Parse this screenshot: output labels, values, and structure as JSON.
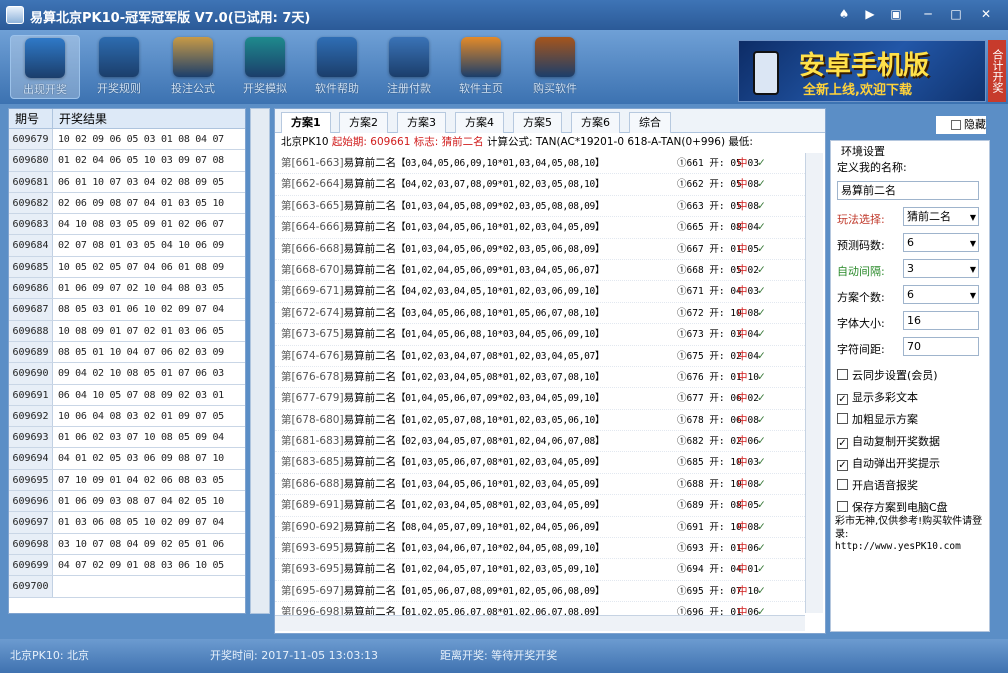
{
  "window": {
    "title": "易算北京PK10-冠军冠军版 V7.0(已试用: 7天)",
    "controls": [
      "♠",
      "▶",
      "▣",
      "─",
      "□",
      "✕"
    ]
  },
  "toolbar": [
    {
      "label": "出现开奖",
      "color": "#2f79c7"
    },
    {
      "label": "开奖规则",
      "color": "#2d6cb0"
    },
    {
      "label": "投注公式",
      "color": "#c89a46"
    },
    {
      "label": "开奖模拟",
      "color": "#1e8a8d"
    },
    {
      "label": "软件帮助",
      "color": "#2f6eb5"
    },
    {
      "label": "注册付款",
      "color": "#3a73b7"
    },
    {
      "label": "软件主页",
      "color": "#e48a28"
    },
    {
      "label": "购买软件",
      "color": "#a5551c"
    }
  ],
  "banner": {
    "title": "安卓手机版",
    "subtitle": "全新上线,欢迎下载",
    "side_tab": "合计开奖"
  },
  "history": {
    "headers": [
      "期号",
      "开奖结果"
    ],
    "rows": [
      {
        "p": "609679",
        "r": "10 02 09 06 05 03 01 08 04 07"
      },
      {
        "p": "609680",
        "r": "01 02 04 06 05 10 03 09 07 08"
      },
      {
        "p": "609681",
        "r": "06 01 10 07 03 04 02 08 09 05"
      },
      {
        "p": "609682",
        "r": "02 06 09 08 07 04 01 03 05 10"
      },
      {
        "p": "609683",
        "r": "04 10 08 03 05 09 01 02 06 07"
      },
      {
        "p": "609684",
        "r": "02 07 08 01 03 05 04 10 06 09"
      },
      {
        "p": "609685",
        "r": "10 05 02 05 07 04 06 01 08 09"
      },
      {
        "p": "609686",
        "r": "01 06 09 07 02 10 04 08 03 05"
      },
      {
        "p": "609687",
        "r": "08 05 03 01 06 10 02 09 07 04"
      },
      {
        "p": "609688",
        "r": "10 08 09 01 07 02 01 03 06 05"
      },
      {
        "p": "609689",
        "r": "08 05 01 10 04 07 06 02 03 09"
      },
      {
        "p": "609690",
        "r": "09 04 02 10 08 05 01 07 06 03"
      },
      {
        "p": "609691",
        "r": "06 04 10 05 07 08 09 02 03 01"
      },
      {
        "p": "609692",
        "r": "10 06 04 08 03 02 01 09 07 05"
      },
      {
        "p": "609693",
        "r": "01 06 02 03 07 10 08 05 09 04"
      },
      {
        "p": "609694",
        "r": "04 01 02 05 03 06 09 08 07 10"
      },
      {
        "p": "609695",
        "r": "07 10 09 01 04 02 06 08 03 05"
      },
      {
        "p": "609696",
        "r": "01 06 09 03 08 07 04 02 05 10"
      },
      {
        "p": "609697",
        "r": "01 03 06 08 05 10 02 09 07 04"
      },
      {
        "p": "609698",
        "r": "03 10 07 08 04 09 02 05 01 06"
      },
      {
        "p": "609699",
        "r": "04 07 02 09 01 08 03 06 10 05"
      },
      {
        "p": "609700",
        "r": ""
      }
    ]
  },
  "tabs": [
    "方案1",
    "方案2",
    "方案3",
    "方案4",
    "方案5",
    "方案6",
    "综合"
  ],
  "info": {
    "prefix": "北京PK10",
    "start_label": "起始期: 609661",
    "name_label": "标志: 猜前二名",
    "formula": "计算公式: TAN(AC*19201-0 618-A-TAN(0+996) 最低:"
  },
  "plans": [
    {
      "range": "第[661-663]",
      "name": "易算前二名",
      "nums": "【03,04,05,06,09,10*01,03,04,05,08,10】",
      "kai": "①661 开: 05 03",
      "hit": "中",
      "ok": "✓"
    },
    {
      "range": "第[662-664]",
      "name": "易算前二名",
      "nums": "【04,02,03,07,08,09*01,02,03,05,08,10】",
      "kai": "①662 开: 05 08",
      "hit": "中",
      "ok": "✓"
    },
    {
      "range": "第[663-665]",
      "name": "易算前二名",
      "nums": "【01,03,04,05,08,09*02,03,05,08,08,09】",
      "kai": "①663 开: 05 08",
      "hit": "中",
      "ok": "✓"
    },
    {
      "range": "第[664-666]",
      "name": "易算前二名",
      "nums": "【01,03,04,05,06,10*01,02,03,04,05,09】",
      "kai": "①665 开: 08 04",
      "hit": "中",
      "ok": "✓"
    },
    {
      "range": "第[666-668]",
      "name": "易算前二名",
      "nums": "【01,03,04,05,06,09*02,03,05,06,08,09】",
      "kai": "①667 开: 01 05",
      "hit": "中",
      "ok": "✓"
    },
    {
      "range": "第[668-670]",
      "name": "易算前二名",
      "nums": "【01,02,04,05,06,09*01,03,04,05,06,07】",
      "kai": "①668 开: 05 02",
      "hit": "中",
      "ok": "✓"
    },
    {
      "range": "第[669-671]",
      "name": "易算前二名",
      "nums": "【04,02,03,04,05,10*01,02,03,06,09,10】",
      "kai": "①671 开: 04 03",
      "hit": "中",
      "ok": "✓"
    },
    {
      "range": "第[672-674]",
      "name": "易算前二名",
      "nums": "【03,04,05,06,08,10*01,05,06,07,08,10】",
      "kai": "①672 开: 10 08",
      "hit": "中",
      "ok": "✓"
    },
    {
      "range": "第[673-675]",
      "name": "易算前二名",
      "nums": "【01,04,05,06,08,10*03,04,05,06,09,10】",
      "kai": "①673 开: 03 04",
      "hit": "中",
      "ok": "✓"
    },
    {
      "range": "第[674-676]",
      "name": "易算前二名",
      "nums": "【01,02,03,04,07,08*01,02,03,04,05,07】",
      "kai": "①675 开: 02 04",
      "hit": "中",
      "ok": "✓"
    },
    {
      "range": "第[676-678]",
      "name": "易算前二名",
      "nums": "【01,02,03,04,05,08*01,02,03,07,08,10】",
      "kai": "①676 开: 01 10",
      "hit": "中",
      "ok": "✓"
    },
    {
      "range": "第[677-679]",
      "name": "易算前二名",
      "nums": "【01,04,05,06,07,09*02,03,04,05,09,10】",
      "kai": "①677 开: 06 02",
      "hit": "中",
      "ok": "✓"
    },
    {
      "range": "第[678-680]",
      "name": "易算前二名",
      "nums": "【01,02,05,07,08,10*01,02,03,05,06,10】",
      "kai": "①678 开: 06 08",
      "hit": "中",
      "ok": "✓"
    },
    {
      "range": "第[681-683]",
      "name": "易算前二名",
      "nums": "【02,03,04,05,07,08*01,02,04,06,07,08】",
      "kai": "①682 开: 02 06",
      "hit": "中",
      "ok": "✓"
    },
    {
      "range": "第[683-685]",
      "name": "易算前二名",
      "nums": "【01,03,05,06,07,08*01,02,03,04,05,09】",
      "kai": "①685 开: 10 03",
      "hit": "中",
      "ok": "✓"
    },
    {
      "range": "第[686-688]",
      "name": "易算前二名",
      "nums": "【01,03,04,05,06,10*01,02,03,04,05,09】",
      "kai": "①688 开: 10 08",
      "hit": "中",
      "ok": "✓"
    },
    {
      "range": "第[689-691]",
      "name": "易算前二名",
      "nums": "【01,02,03,04,05,08*01,02,03,04,05,09】",
      "kai": "①689 开: 08 05",
      "hit": "中",
      "ok": "✓"
    },
    {
      "range": "第[690-692]",
      "name": "易算前二名",
      "nums": "【08,04,05,07,09,10*01,02,04,05,06,09】",
      "kai": "①691 开: 10 08",
      "hit": "中",
      "ok": "✓"
    },
    {
      "range": "第[693-695]",
      "name": "易算前二名",
      "nums": "【01,03,04,06,07,10*02,04,05,08,09,10】",
      "kai": "①693 开: 01 06",
      "hit": "中",
      "ok": "✓"
    },
    {
      "range": "第[693-695]",
      "name": "易算前二名",
      "nums": "【01,02,04,05,07,10*01,02,03,05,09,10】",
      "kai": "①694 开: 04 01",
      "hit": "中",
      "ok": "✓"
    },
    {
      "range": "第[695-697]",
      "name": "易算前二名",
      "nums": "【01,05,06,07,08,09*01,02,05,06,08,09】",
      "kai": "①695 开: 07 10",
      "hit": "中",
      "ok": "✓"
    },
    {
      "range": "第[696-698]",
      "name": "易算前二名",
      "nums": "【01,02,05,06,07,08*01,02,06,07,08,09】",
      "kai": "①696 开: 01 06",
      "hit": "中",
      "ok": "✓"
    }
  ],
  "settings": {
    "title": "环境设置",
    "hide_label": "隐藏",
    "name_label": "定义我的名称:",
    "name_value": "易算前二名",
    "play_label": "玩法选择:",
    "play_value": "猜前二名",
    "predict_label": "预测码数:",
    "predict_value": "6",
    "interval_label": "自动间隔:",
    "interval_value": "3",
    "lines_label": "方案个数:",
    "lines_value": "6",
    "font_label": "字体大小:",
    "font_value": "16",
    "spacing_label": "字符间距:",
    "spacing_value": "70",
    "checks": [
      {
        "label": "云同步设置(会员)",
        "checked": false
      },
      {
        "label": "显示多彩文本",
        "checked": true
      },
      {
        "label": "加粗显示方案",
        "checked": false
      },
      {
        "label": "自动复制开奖数据",
        "checked": true
      },
      {
        "label": "自动弹出开奖提示",
        "checked": true
      },
      {
        "label": "开启语音报奖",
        "checked": false
      },
      {
        "label": "保存方案到电脑C盘",
        "checked": false
      }
    ],
    "note": "彩市无神,仅供参考!购买软件请登录:",
    "url": "http://www.yesPK10.com"
  },
  "status": {
    "left": "北京PK10: 北京",
    "middle": "开奖时间: 2017-11-05 13:03:13",
    "right": "距离开奖: 等待开奖开奖"
  }
}
